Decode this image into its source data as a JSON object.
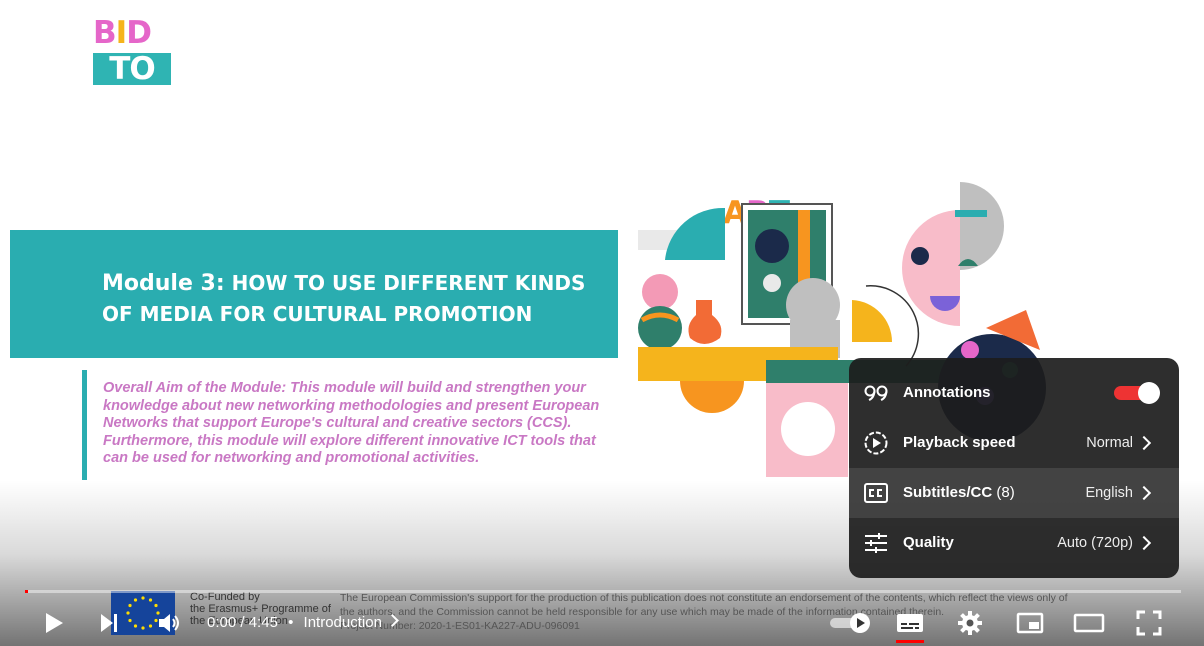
{
  "logo": {
    "row1": [
      "B",
      "I",
      "D"
    ],
    "row2": [
      "T",
      "O"
    ],
    "row3": [
      "A",
      "R",
      "T"
    ]
  },
  "slide": {
    "module_prefix": "Module 3:",
    "title_line1": "HOW TO USE DIFFERENT KINDS",
    "title_line2": "OF MEDIA FOR CULTURAL PROMOTION",
    "aim": "Overall Aim of the Module: This module will build and strengthen your knowledge about new networking methodologies and present European Networks that support Europe's cultural and creative sectors (CCS). Furthermore, this module will explore different innovative ICT tools that can be used for networking and promotional activities."
  },
  "footer": {
    "cofund_line1": "Co-Funded by",
    "cofund_line2": "the Erasmus+ Programme of",
    "cofund_line3": "the European Union",
    "disclaimer": "The European Commission's support for the production of this publication does not constitute an endorsement of the contents, which reflect the views only of the authors, and the Commission cannot be held responsible for any use which may be made of the information contained therein.",
    "project_number": "Project Number: 2020-1-ES01-KA227-ADU-096091"
  },
  "player": {
    "current_time": "0:00",
    "separator": "/",
    "duration": "4:45",
    "bullet": "•",
    "chapter": "Introduction",
    "progress_fraction": 0.002,
    "accent_color": "#ff0000"
  },
  "settings_menu": {
    "items": [
      {
        "label": "Annotations",
        "icon": "annotations-icon",
        "toggle_on": true
      },
      {
        "label": "Playback speed",
        "icon": "playback-speed-icon",
        "value": "Normal"
      },
      {
        "label": "Subtitles/CC",
        "count": "(8)",
        "icon": "subtitles-icon",
        "value": "English"
      },
      {
        "label": "Quality",
        "icon": "quality-icon",
        "value": "Auto (720p)"
      }
    ]
  }
}
